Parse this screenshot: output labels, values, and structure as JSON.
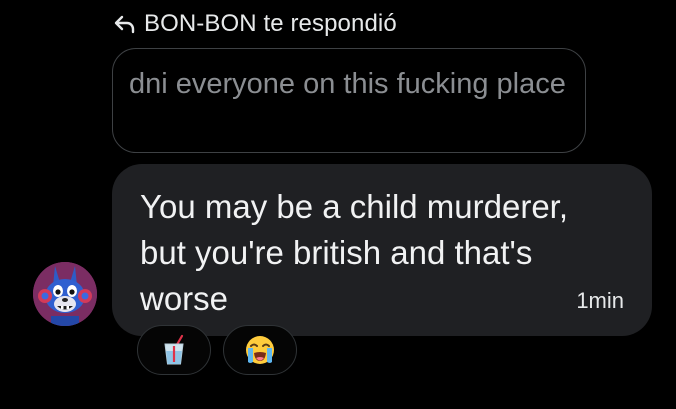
{
  "reply_header": {
    "text": "BON-BON te respondió",
    "icon": "reply-arrow-icon"
  },
  "quoted_message": {
    "text": "dni everyone on this fucking place"
  },
  "message": {
    "text": "You may be a child murderer, but you're british and that's worse",
    "timestamp": "1min"
  },
  "avatar": {
    "icon": "bonnie-avatar"
  },
  "reactions": [
    {
      "icon": "cup-with-straw-emoji"
    },
    {
      "icon": "loudly-crying-face-emoji"
    }
  ]
}
